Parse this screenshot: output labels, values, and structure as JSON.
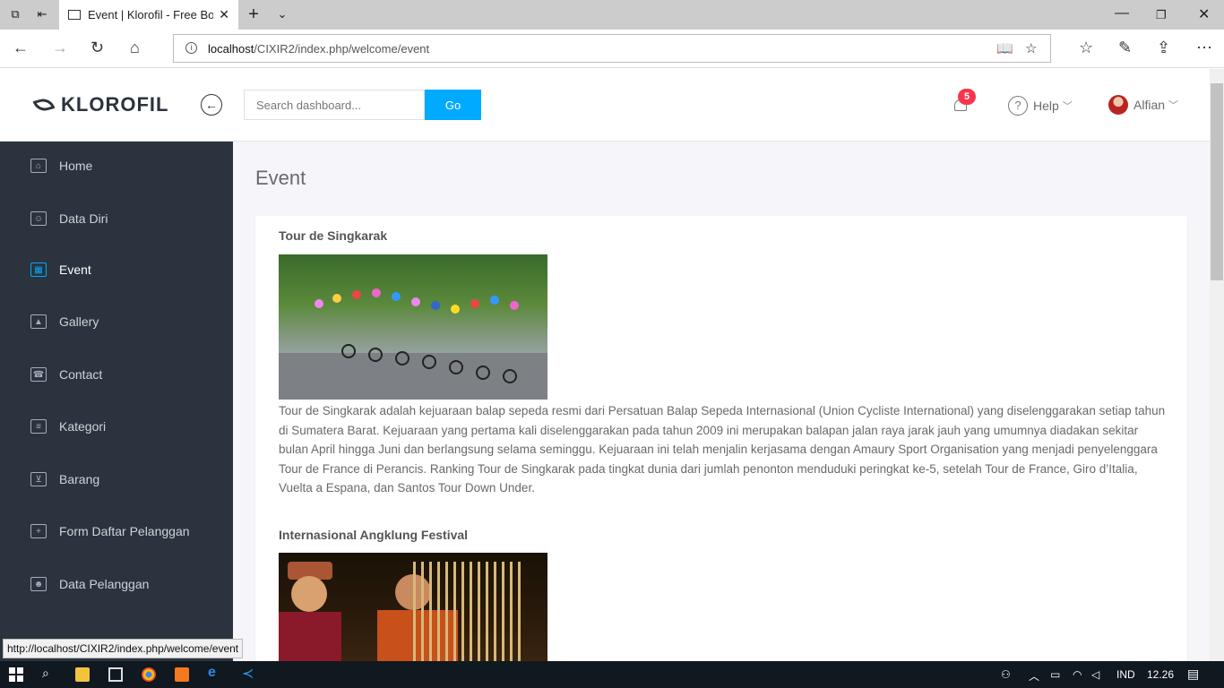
{
  "browser": {
    "tab_title": "Event | Klorofil - Free Bo",
    "url_host": "localhost",
    "url_path": "/CIXIR2/index.php/welcome/event"
  },
  "header": {
    "logo_text": "KLOROFIL",
    "search_placeholder": "Search dashboard...",
    "go_label": "Go",
    "notification_count": "5",
    "help_label": "Help",
    "user_name": "Alfian"
  },
  "sidebar": {
    "items": [
      {
        "label": "Home",
        "icon": "home-icon"
      },
      {
        "label": "Data Diri",
        "icon": "user-icon"
      },
      {
        "label": "Event",
        "icon": "calendar-icon",
        "active": true
      },
      {
        "label": "Gallery",
        "icon": "image-icon"
      },
      {
        "label": "Contact",
        "icon": "phone-icon"
      },
      {
        "label": "Kategori",
        "icon": "list-icon"
      },
      {
        "label": "Barang",
        "icon": "cart-icon"
      },
      {
        "label": "Form Daftar Pelanggan",
        "icon": "file-add-icon"
      },
      {
        "label": "Data Pelanggan",
        "icon": "users-icon"
      }
    ]
  },
  "main": {
    "page_title": "Event",
    "events": [
      {
        "title": "Tour de Singkarak",
        "description": "Tour de Singkarak adalah kejuaraan balap sepeda resmi dari Persatuan Balap Sepeda Internasional (Union Cycliste International) yang diselenggarakan setiap tahun di Sumatera Barat. Kejuaraan yang pertama kali diselenggarakan pada tahun 2009 ini merupakan balapan jalan raya jarak jauh yang umumnya diadakan sekitar bulan April hingga Juni dan berlangsung selama seminggu. Kejuaraan ini telah menjalin kerjasama dengan Amaury Sport Organisation yang menjadi penyelenggara Tour de France di Perancis. Ranking Tour de Singkarak pada tingkat dunia dari jumlah penonton menduduki peringkat ke-5, setelah Tour de France, Giro d’Italia, Vuelta a Espana, dan Santos Tour Down Under."
      },
      {
        "title": "Internasional Angklung Festival"
      }
    ]
  },
  "status_bar": {
    "link": "http://localhost/CIXIR2/index.php/welcome/event"
  },
  "taskbar": {
    "language": "IND",
    "time": "12.26"
  },
  "colors": {
    "sidebar_bg": "#2b333e",
    "accent": "#00aaff",
    "badge": "#f9354c",
    "main_bg": "#f5f5fa"
  }
}
